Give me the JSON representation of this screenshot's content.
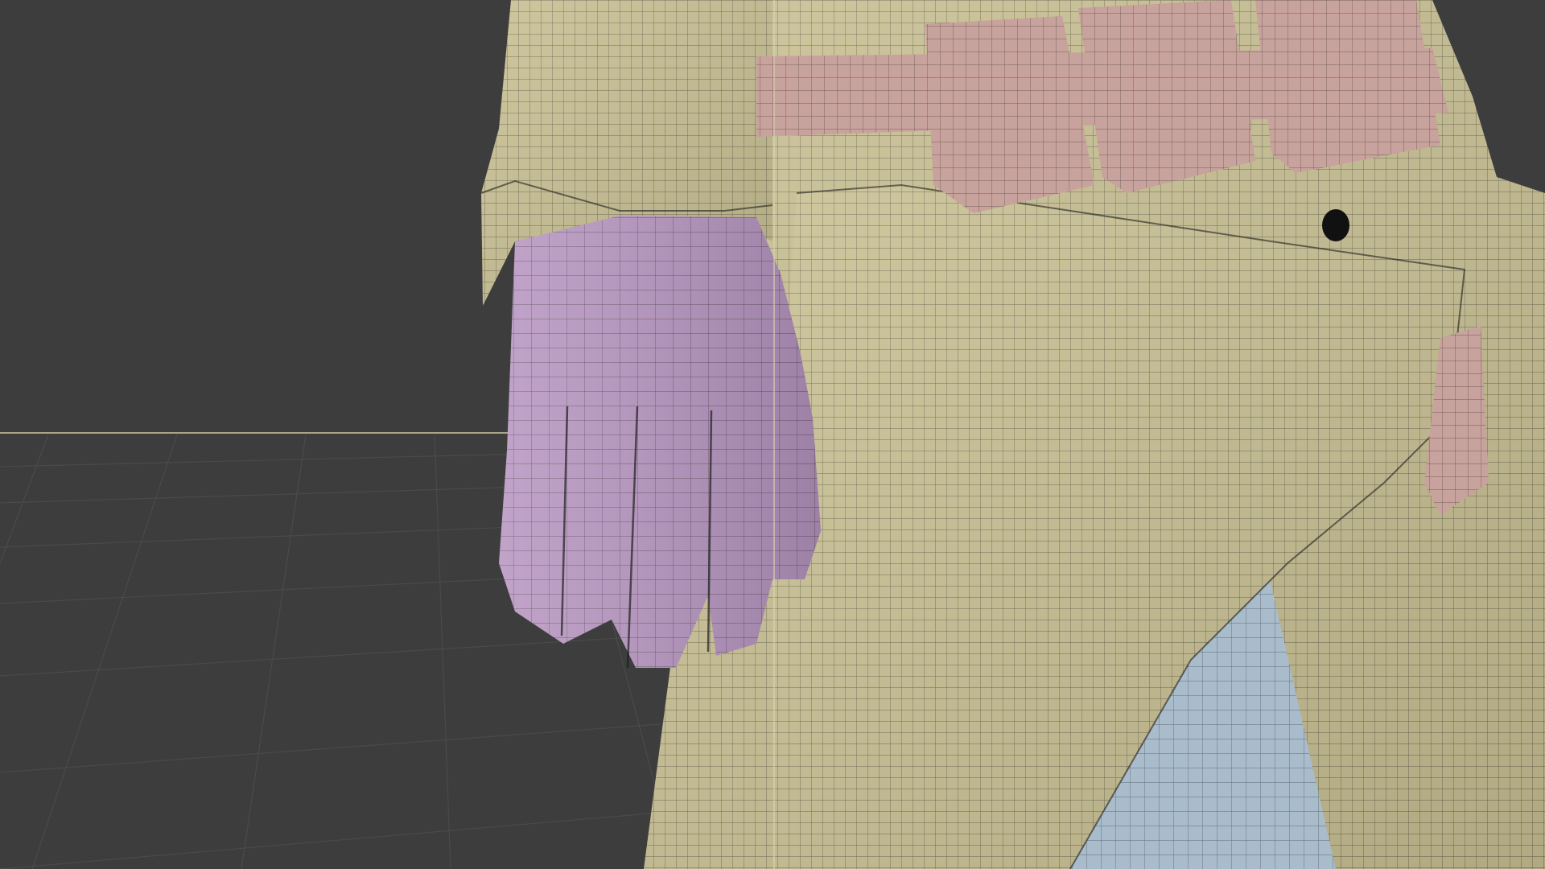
{
  "viewport": {
    "background_color": "#3d3d3d",
    "grid_color": "#4a4a4a",
    "horizon_color": "#cfc8a2",
    "wire_color": "#1e1e1e",
    "objects": [
      {
        "name": "coat",
        "color": "#c9c093"
      },
      {
        "name": "glove",
        "color": "#b997c2"
      },
      {
        "name": "belt-pouches",
        "color": "#c8a29c"
      },
      {
        "name": "trousers",
        "color": "#a9bccb"
      }
    ]
  }
}
